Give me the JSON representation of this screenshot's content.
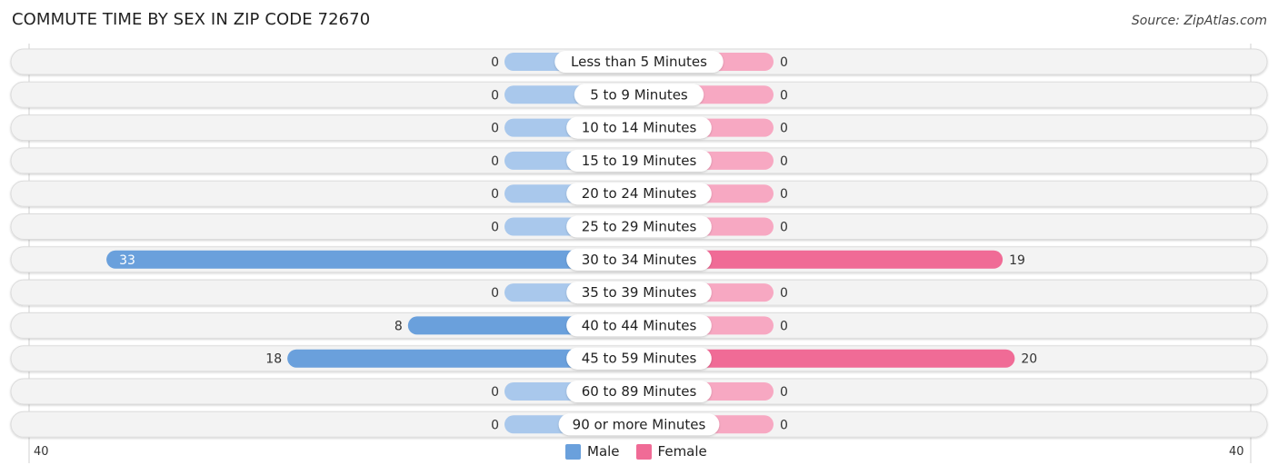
{
  "title": "COMMUTE TIME BY SEX IN ZIP CODE 72670",
  "source": "Source: ZipAtlas.com",
  "colors": {
    "male": "#6aa0dc",
    "male_light": "#a9c8ec",
    "female": "#f06b96",
    "female_light": "#f7a8c2",
    "row_bg": "#f3f3f3"
  },
  "legend": {
    "male": "Male",
    "female": "Female"
  },
  "axis": {
    "left_label": "40",
    "right_label": "40"
  },
  "chart_data": {
    "type": "bar",
    "orientation": "horizontal-diverging",
    "title": "COMMUTE TIME BY SEX IN ZIP CODE 72670",
    "categories": [
      "Less than 5 Minutes",
      "5 to 9 Minutes",
      "10 to 14 Minutes",
      "15 to 19 Minutes",
      "20 to 24 Minutes",
      "25 to 29 Minutes",
      "30 to 34 Minutes",
      "35 to 39 Minutes",
      "40 to 44 Minutes",
      "45 to 59 Minutes",
      "60 to 89 Minutes",
      "90 or more Minutes"
    ],
    "series": [
      {
        "name": "Male",
        "values": [
          0,
          0,
          0,
          0,
          0,
          0,
          33,
          0,
          8,
          18,
          0,
          0
        ]
      },
      {
        "name": "Female",
        "values": [
          0,
          0,
          0,
          0,
          0,
          0,
          19,
          0,
          0,
          20,
          0,
          0
        ]
      }
    ],
    "xlim": [
      -40,
      40
    ],
    "xtick_labels": [
      "40",
      "40"
    ],
    "legend_position": "bottom-center",
    "grid": false
  }
}
